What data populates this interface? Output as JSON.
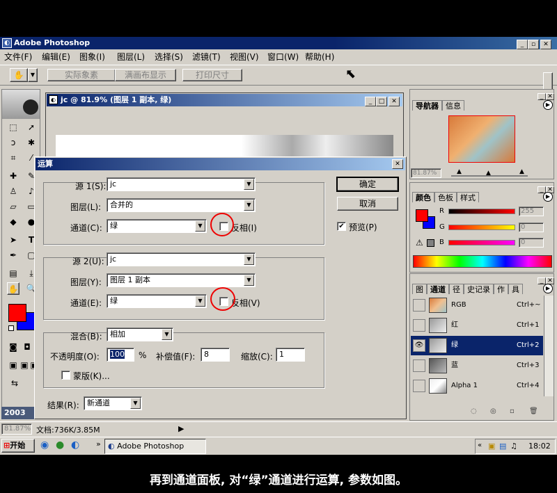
{
  "app": {
    "title": "Adobe Photoshop"
  },
  "window_controls": [
    "_",
    "▫",
    "✕"
  ],
  "menu": [
    "文件(F)",
    "编辑(E)",
    "图象(I)",
    "图层(L)",
    "选择(S)",
    "滤镜(T)",
    "视图(V)",
    "窗口(W)",
    "帮助(H)"
  ],
  "options_bar": {
    "buttons": [
      "实际象素",
      "满画布显示",
      "打印尺寸"
    ]
  },
  "document": {
    "title": "jc @ 81.9% (图层 1 副本, 绿)"
  },
  "dialog": {
    "title": "运算",
    "source1": {
      "label": "源 1(S):",
      "value": "jc"
    },
    "layer1": {
      "label": "图层(L):",
      "value": "合并的"
    },
    "channel1": {
      "label": "通道(C):",
      "value": "绿",
      "invert_label": "反相(I)"
    },
    "source2": {
      "label": "源 2(U):",
      "value": "jc"
    },
    "layer2": {
      "label": "图层(Y):",
      "value": "图层 1 副本"
    },
    "channel2": {
      "label": "通道(E):",
      "value": "绿",
      "invert_label": "反相(V)"
    },
    "blend": {
      "label": "混合(B):",
      "value": "相加"
    },
    "opacity": {
      "label": "不透明度(O):",
      "value": "100",
      "unit": "%"
    },
    "offset": {
      "label": "补偿值(F):",
      "value": "8"
    },
    "scale": {
      "label": "缩放(C):",
      "value": "1"
    },
    "mask": {
      "label": "蒙版(K)..."
    },
    "result": {
      "label": "结果(R):",
      "value": "新通道"
    },
    "ok": "确定",
    "cancel": "取消",
    "preview": "预览(P)"
  },
  "navigator": {
    "tabs": [
      "导航器",
      "信息"
    ],
    "zoom": "81.87%"
  },
  "color_panel": {
    "tabs": [
      "颜色",
      "色板",
      "样式"
    ],
    "sliders": [
      {
        "label": "R",
        "value": "255"
      },
      {
        "label": "G",
        "value": "0"
      },
      {
        "label": "B",
        "value": "0"
      }
    ],
    "foreground": "#ff0000",
    "background": "#0000ff"
  },
  "channels_panel": {
    "tabs": [
      "图",
      "通道",
      "径",
      "史记录",
      "作",
      "具"
    ],
    "rows": [
      {
        "name": "RGB",
        "key": "Ctrl+~"
      },
      {
        "name": "红",
        "key": "Ctrl+1"
      },
      {
        "name": "绿",
        "key": "Ctrl+2"
      },
      {
        "name": "蓝",
        "key": "Ctrl+3"
      },
      {
        "name": "Alpha 1",
        "key": "Ctrl+4"
      }
    ]
  },
  "status": {
    "zoom": "81.87%",
    "doc": "文档:736K/3.85M"
  },
  "toolbox_label": "2003",
  "taskbar": {
    "start": "开始",
    "task": "Adobe Photoshop",
    "clock": "18:02"
  },
  "caption": "再到通道面板, 对“绿”通道进行运算, 参数如图。"
}
